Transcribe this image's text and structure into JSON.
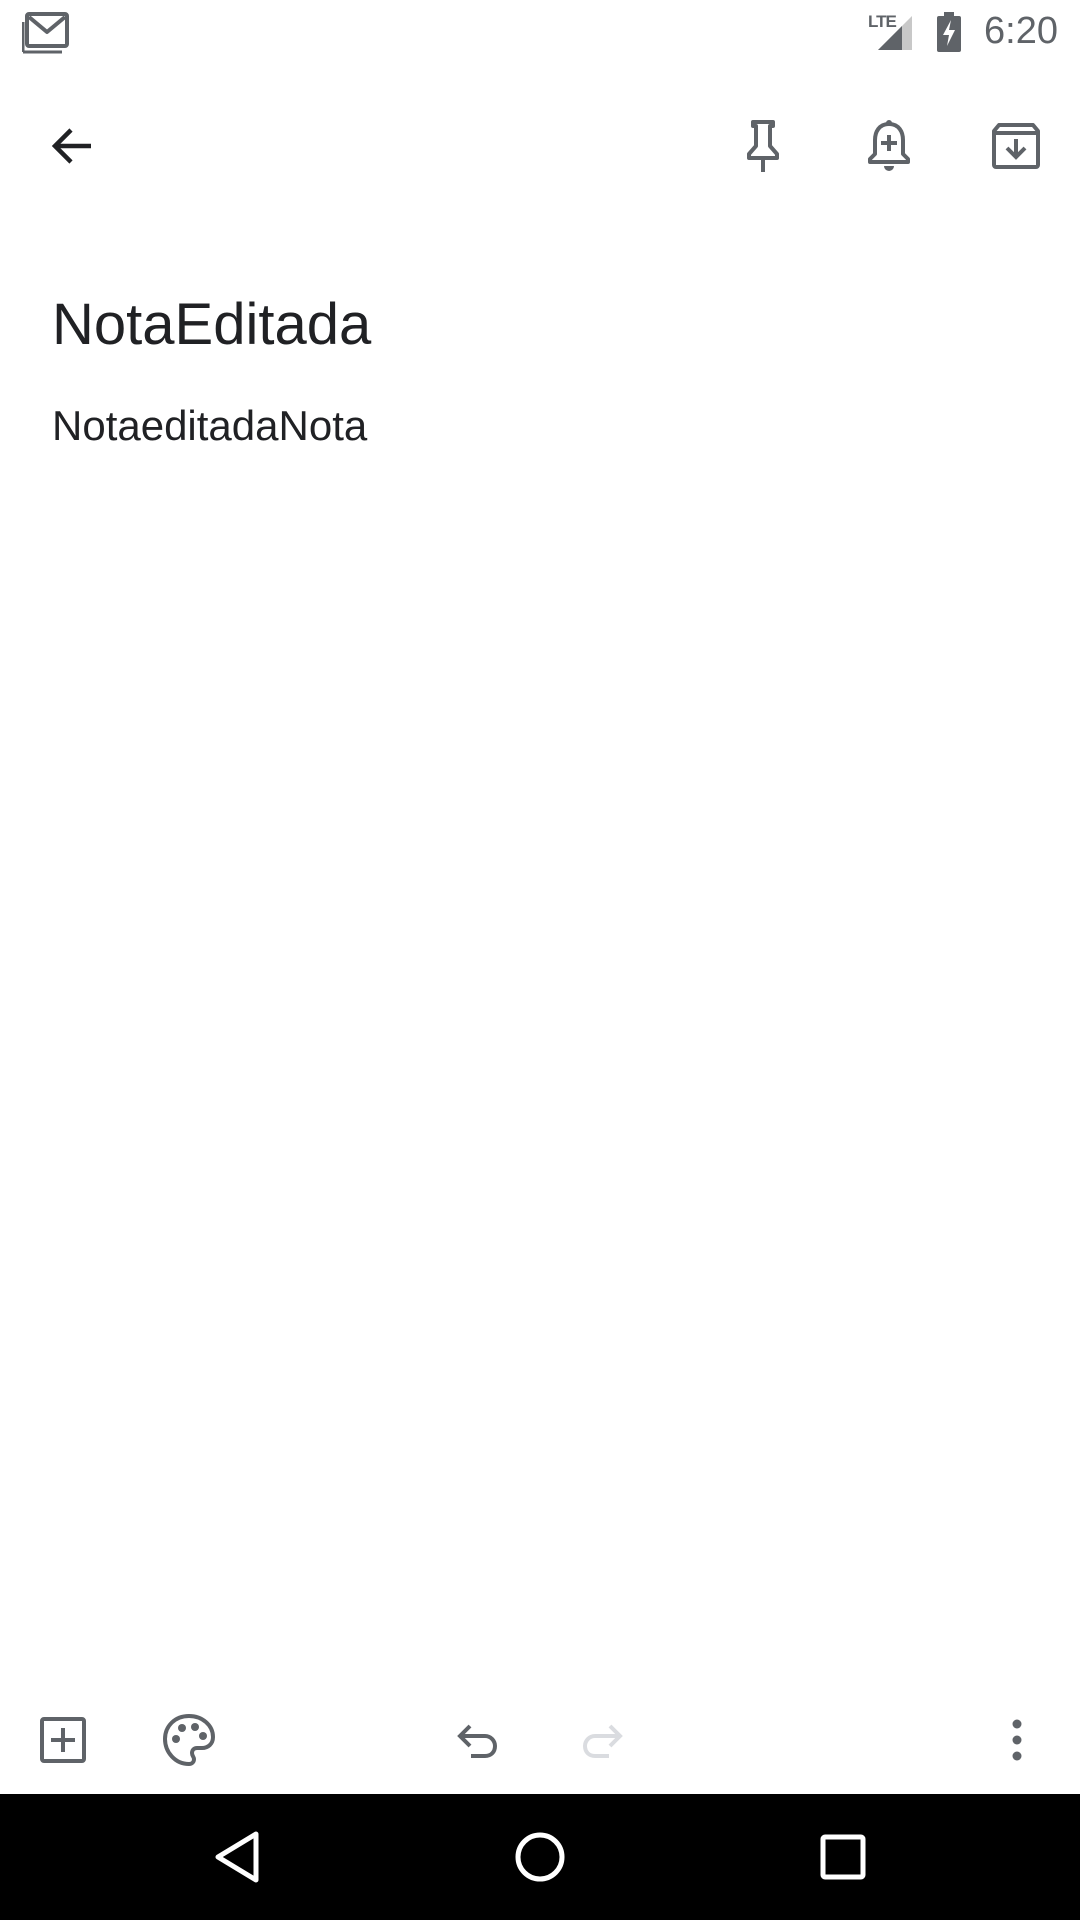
{
  "status_bar": {
    "network_label": "LTE",
    "time": "6:20",
    "icons": [
      "gmail-icon",
      "lte-signal-icon",
      "battery-charging-icon"
    ]
  },
  "top_toolbar": {
    "icons": [
      "back-arrow-icon",
      "pin-icon",
      "add-reminder-icon",
      "archive-icon"
    ]
  },
  "note": {
    "title": "NotaEditada",
    "body": "NotaeditadaNota"
  },
  "bottom_toolbar": {
    "icons": [
      "add-box-icon",
      "palette-icon",
      "undo-icon",
      "redo-icon",
      "more-vert-icon"
    ],
    "redo_enabled": false
  },
  "nav_bar": {
    "icons": [
      "nav-back-icon",
      "nav-home-icon",
      "nav-recents-icon"
    ]
  },
  "colors": {
    "icon": "#5f6368",
    "text": "#202124",
    "disabled_icon": "#dadce0",
    "nav_background": "#000000",
    "background": "#ffffff"
  }
}
